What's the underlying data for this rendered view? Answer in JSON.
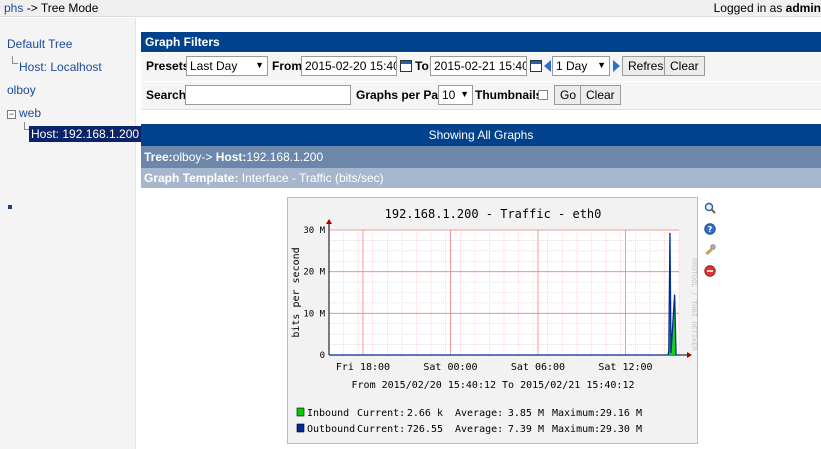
{
  "topbar": {
    "crumb_link": "phs",
    "crumb_rest": " -> Tree Mode",
    "logged_in_prefix": "Logged in as ",
    "user": "admin"
  },
  "tree": {
    "items": [
      {
        "label": "Default Tree"
      },
      {
        "label": "Host: Localhost"
      },
      {
        "label": "olboy"
      },
      {
        "label": "web"
      },
      {
        "label": "Host: 192.168.1.200"
      }
    ],
    "expander_symbol": "−"
  },
  "filters": {
    "title": "Graph Filters",
    "presets_label": "Presets:",
    "preset_value": "Last Day",
    "from_label": "From:",
    "from_value": "2015-02-20 15:40",
    "to_label": "To:",
    "to_value": "2015-02-21 15:40",
    "shift_value": "1 Day",
    "refresh_label": "Refresh",
    "clear_label": "Clear",
    "search_label": "Search:",
    "search_value": "",
    "per_page_label": "Graphs per Page:",
    "per_page_value": "10",
    "thumbnails_label": "Thumbnails:",
    "go_label": "Go",
    "clear2_label": "Clear"
  },
  "showing": "Showing All Graphs",
  "tree_bar": {
    "tree_prefix": "Tree:",
    "tree_name": "olboy->",
    "host_prefix": " Host:",
    "host": "192.168.1.200"
  },
  "template_bar": {
    "label": "Graph Template:",
    "value": " Interface - Traffic (bits/sec)"
  },
  "colors": {
    "header_blue": "#00438c",
    "inbound": "#00cc00",
    "outbound": "#002a97",
    "grid_major": "#f08080",
    "grid_minor": "#f5c0c0"
  },
  "side_icons": [
    "zoom-icon",
    "info-icon",
    "edit-icon",
    "delete-icon"
  ],
  "watermark": "RRDTOOL / TOBI OETIKER",
  "chart_data": {
    "type": "area",
    "title": "192.168.1.200 - Traffic - eth0",
    "ylabel": "bits per second",
    "ylim": [
      0,
      30000000
    ],
    "ytick_labels": [
      "0",
      "10 M",
      "20 M",
      "30 M"
    ],
    "ytick_values": [
      0,
      10000000,
      20000000,
      30000000
    ],
    "xlim": [
      "2015-02-20 15:40:12",
      "2015-02-21 15:40:12"
    ],
    "xtick_labels": [
      "Fri 18:00",
      "Sat 00:00",
      "Sat 06:00",
      "Sat 12:00"
    ],
    "xtick_hours_from_start": [
      2.33,
      8.33,
      14.33,
      20.33
    ],
    "range_text": "From 2015/02/20 15:40:12 To 2015/02/21 15:40:12",
    "series": [
      {
        "name": "Inbound",
        "color": "#00cc00",
        "points": [
          [
            0,
            0
          ],
          [
            23.25,
            0
          ],
          [
            23.3,
            2000000
          ],
          [
            23.38,
            29160000
          ],
          [
            23.45,
            800000
          ],
          [
            23.7,
            15000000
          ],
          [
            23.8,
            0
          ],
          [
            24,
            0
          ]
        ],
        "current": "2.66 k",
        "average": "3.85 M",
        "maximum": "29.16 M"
      },
      {
        "name": "Outbound",
        "color": "#002a97",
        "points": [
          [
            0,
            0
          ],
          [
            23.25,
            0
          ],
          [
            23.3,
            1000000
          ],
          [
            23.38,
            29300000
          ],
          [
            23.45,
            500000
          ],
          [
            23.7,
            14500000
          ],
          [
            23.8,
            0
          ],
          [
            24,
            0
          ]
        ],
        "current": "726.55",
        "average": "7.39 M",
        "maximum": "29.30 M"
      }
    ],
    "legend_labels": {
      "current": "Current:",
      "average": "Average:",
      "maximum": "Maximum:"
    }
  }
}
